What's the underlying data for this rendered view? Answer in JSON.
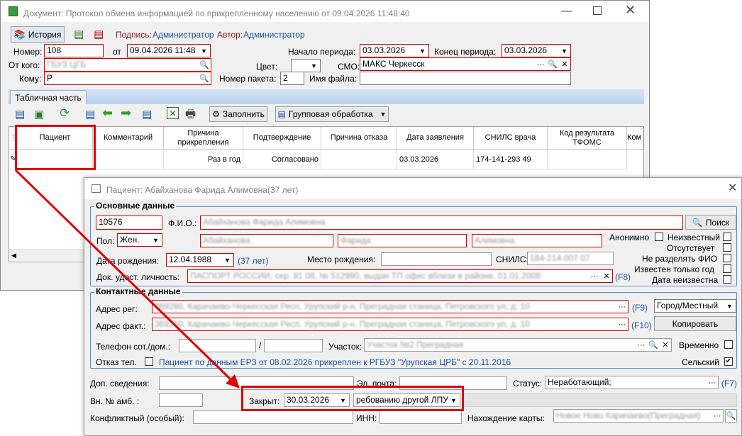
{
  "doc": {
    "title": "Документ: Протокол обмена информацией по прикрепленному населению от 09.04.2026 11:48:40",
    "history_label": "История",
    "signed_label": "Подпись:",
    "signed_value": "Администратор",
    "author_label": "Автор:",
    "author_value": "Администратор",
    "number_label": "Номер:",
    "number_value": "108",
    "from_label": "от",
    "from_value": "09.04.2026 11:48",
    "sender_label": "От кого:",
    "sender_value": "ГБУЗ ЦГБ",
    "recipient_label": "Кому:",
    "recipient_value": "Р",
    "period_start_label": "Начало периода:",
    "period_start_value": "03.03.2026",
    "period_end_label": "Конец периода:",
    "period_end_value": "03.03.2026",
    "color_label": "Цвет:",
    "smo_label": "СМО:",
    "smo_value": "МАКС Черкесск",
    "packet_label": "Номер пакета:",
    "packet_value": "2",
    "filename_label": "Имя файла:",
    "tab_label": "Табличная часть",
    "fill_label": "Заполнить",
    "group_label": "Групповая обработка",
    "columns": [
      "Пациент",
      "Комментарий",
      "Причина прикрепления",
      "Подтверждение",
      "Причина отказа",
      "Дата заявления",
      "СНИЛС врача",
      "Код результата ТФОМС",
      "Ком"
    ],
    "row": [
      "",
      "",
      "Раз в год",
      "Согласовано",
      "",
      "03.03.2026",
      "174-141-293 49",
      "",
      ""
    ]
  },
  "patient": {
    "title": "Пациент: Абайханова Фарида Алимовна(37 лет)",
    "basic_title": "Основные данные",
    "id_value": "10576",
    "fio_label": "Ф.И.О.:",
    "fio_value": "Абайханова Фарида Алимовна",
    "search_label": "Поиск",
    "gender_label": "Пол:",
    "gender_value": "Жен.",
    "last_name": "Абайханова",
    "first_name": "Фарида",
    "middle_name": "Алимовна",
    "anonymous_label": "Анонимно",
    "unknown_label": "Неизвестный",
    "absent_label": "Отсутствует",
    "no_split_label": "Не разделять ФИО",
    "year_only_label": "Известен только год",
    "date_unknown_label": "Дата неизвестна",
    "birth_label": "Дата рождения:",
    "birth_value": "12.04.1988",
    "age_value": "(37 лет)",
    "birthplace_label": "Место рождения:",
    "snils_label": "СНИЛС:",
    "snils_value": "184-214-007 07",
    "doc_label": "Док. удост. личность:",
    "doc_value": "ПАСПОРТ РОССИИ, сер. 91 08, № 512990, выдан ТП офис вблизи в районе, 01.01.2008",
    "doc_hotkey": "(F8)",
    "contact_title": "Контактные данные",
    "addr_reg_label": "Адрес рег:",
    "addr_reg_value": "369260, Карачаево-Черкесская Респ, Урупский р-н, Преградная станица, Петровского ул, д. 10",
    "addr_reg_hotkey": "(F9)",
    "addr_type_value": "Город/Местный",
    "addr_fact_label": "Адрес факт.:",
    "addr_fact_value": "369260, Карачаево-Черкесская Респ, Урупский р-н, Преградная станица, Петровского ул, д. 10",
    "addr_fact_hotkey": "(F10)",
    "copy_label": "Копировать",
    "phone_label": "Телефон сот./дом.:",
    "phone_sep": "/",
    "district_label": "Участок:",
    "district_value": "Участок №2 Преградная",
    "temporary_label": "Временно",
    "phone_refuse_label": "Отказ тел.",
    "erz_text": "Пациент по данным ЕРЗ от 08.02.2026 прикреплен к РГБУЗ \"Урупская ЦРБ\" с 20.11.2016",
    "rural_label": "Сельский",
    "extra_label": "Доп. сведения:",
    "email_label": "Эл. почта:",
    "status_label": "Статус:",
    "status_value": "Неработающий;",
    "status_hotkey": "(F7)",
    "amb_label": "Вн. № амб. :",
    "closed_label": "Закрыт:",
    "closed_value": "30.03.2026",
    "closed_reason": "ребованию другой ЛПУ",
    "conflict_label": "Конфликтный (особый):",
    "inn_label": "ИНН:",
    "card_label": "Нахождение карты:",
    "card_value": "Новое Ново Карачаево(Преградная)"
  }
}
